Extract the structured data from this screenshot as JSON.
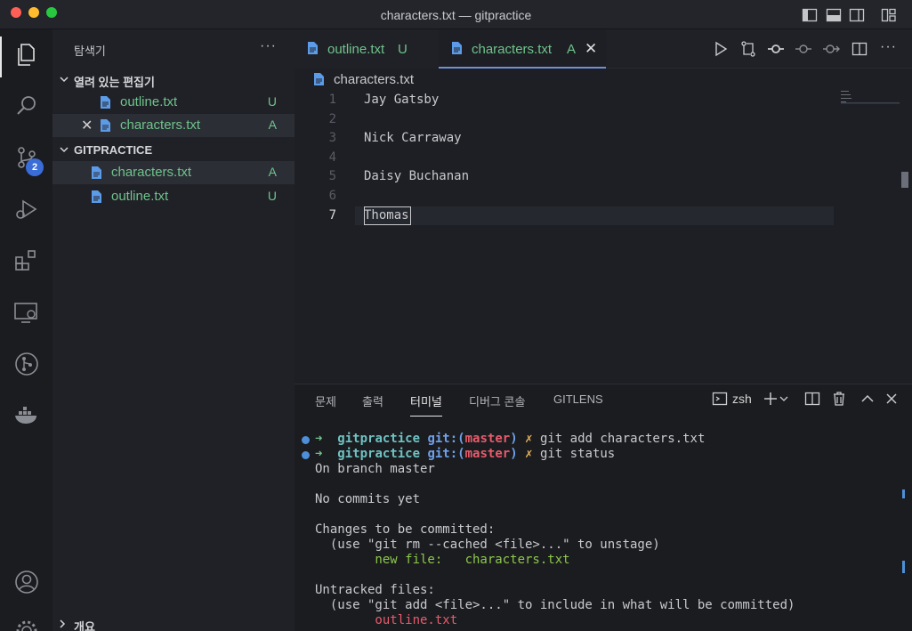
{
  "window": {
    "title": "characters.txt — gitpractice"
  },
  "activity_bar": {
    "items": [
      {
        "name": "explorer-icon"
      },
      {
        "name": "search-icon"
      },
      {
        "name": "source-control-icon"
      },
      {
        "name": "run-debug-icon"
      },
      {
        "name": "extensions-icon"
      },
      {
        "name": "remote-explorer-icon"
      },
      {
        "name": "git-graph-icon"
      },
      {
        "name": "docker-icon"
      },
      {
        "name": "account-icon"
      },
      {
        "name": "settings-gear-icon"
      }
    ],
    "scm_badge": "2"
  },
  "sidebar": {
    "title": "탐색기",
    "more": "···",
    "open_editors": {
      "label": "열려 있는 편집기",
      "items": [
        {
          "name": "outline.txt",
          "badge": "U"
        },
        {
          "name": "characters.txt",
          "badge": "A"
        }
      ]
    },
    "workspace": {
      "label": "GITPRACTICE",
      "items": [
        {
          "name": "characters.txt",
          "badge": "A"
        },
        {
          "name": "outline.txt",
          "badge": "U"
        }
      ]
    },
    "outline_label": "개요"
  },
  "tabs": [
    {
      "name": "outline.txt",
      "badge": "U"
    },
    {
      "name": "characters.txt",
      "badge": "A",
      "close": "✕"
    }
  ],
  "breadcrumb": {
    "file": "characters.txt"
  },
  "editor": {
    "lines": [
      {
        "num": "1",
        "text": "Jay Gatsby"
      },
      {
        "num": "2",
        "text": ""
      },
      {
        "num": "3",
        "text": "Nick Carraway"
      },
      {
        "num": "4",
        "text": ""
      },
      {
        "num": "5",
        "text": "Daisy Buchanan"
      },
      {
        "num": "6",
        "text": ""
      },
      {
        "num": "7",
        "text": "Thomas"
      }
    ]
  },
  "panel": {
    "tabs": [
      "문제",
      "출력",
      "터미널",
      "디버그 콘솔",
      "GITLENS"
    ],
    "active_tab": "터미널",
    "shell": "zsh",
    "terminal": {
      "prompt_arrow": "➜",
      "repo": "gitpractice",
      "git_label": "git:(",
      "branch": "master",
      "git_close": ")",
      "dirty_mark": "✗",
      "cmd1": "git add characters.txt",
      "cmd2": "git status",
      "out1": "On branch master",
      "out2": "No commits yet",
      "out3": "Changes to be committed:",
      "out4": "  (use \"git rm --cached <file>...\" to unstage)",
      "out5_label": "        new file:   ",
      "out5_file": "characters.txt",
      "out6": "Untracked files:",
      "out7": "  (use \"git add <file>...\" to include in what will be committed)",
      "out8": "        outline.txt"
    }
  },
  "colors": {
    "accent": "#3a6dd8",
    "added": "#6fc38b",
    "branch": "#e85b6b",
    "file_icon": "#5b9be8"
  }
}
